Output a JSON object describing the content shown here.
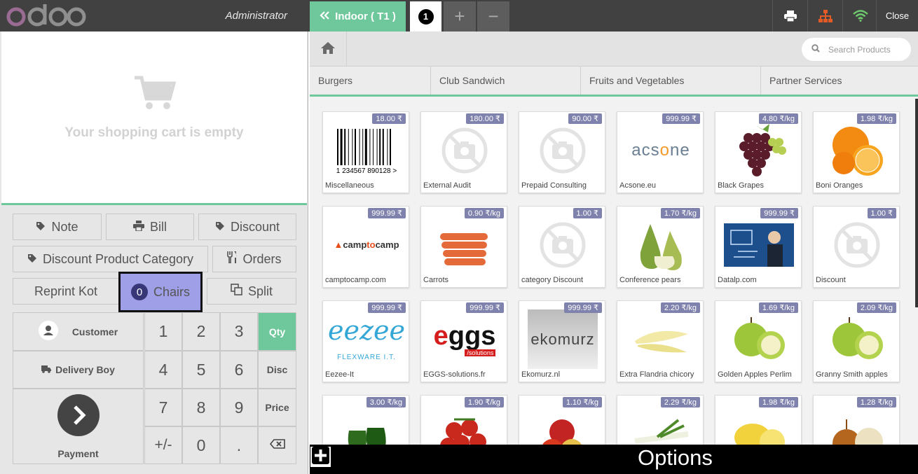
{
  "header": {
    "logo": "odoo",
    "user": "Administrator",
    "current_order": "Indoor ( T1 )",
    "order_number": "1",
    "add_label": "+",
    "delete_label": "−",
    "close_label": "Close",
    "icons": [
      "printer-icon",
      "sitemap-icon",
      "wifi-icon"
    ],
    "wifi_color": "#6ec86e",
    "sitemap_color": "#e25b26"
  },
  "cart": {
    "empty_message": "Your shopping cart is empty"
  },
  "controls": {
    "note": "Note",
    "bill": "Bill",
    "discount": "Discount",
    "discount_category": "Discount Product Category",
    "orders": "Orders",
    "reprint": "Reprint Kot",
    "chairs_count": "0",
    "chairs": "Chairs",
    "split": "Split"
  },
  "numpad": {
    "customer": "Customer",
    "delivery_boy": "Delivery Boy",
    "payment": "Payment",
    "keys": [
      "1",
      "2",
      "3",
      "4",
      "5",
      "6",
      "7",
      "8",
      "9",
      "+/-",
      "0",
      "."
    ],
    "modes": [
      "Qty",
      "Disc",
      "Price"
    ],
    "active_mode": "Qty"
  },
  "products_header": {
    "search_placeholder": "Search Products",
    "categories": [
      "Burgers",
      "Club Sandwich",
      "Fruits and Vegetables",
      "Partner Services"
    ]
  },
  "products": [
    {
      "name": "Miscellaneous",
      "price": "18.00 ₹",
      "img": "barcode",
      "barcode": "1 234567 890128 >"
    },
    {
      "name": "External Audit",
      "price": "180.00 ₹",
      "img": "no-image"
    },
    {
      "name": "Prepaid Consulting",
      "price": "90.00 ₹",
      "img": "no-image"
    },
    {
      "name": "Acsone.eu",
      "price": "999.99 ₹",
      "img": "logo",
      "logo_text": "acsone"
    },
    {
      "name": "Black Grapes",
      "price": "4.80 ₹/kg",
      "img": "grapes"
    },
    {
      "name": "Boni Oranges",
      "price": "1.98 ₹/kg",
      "img": "oranges"
    },
    {
      "name": "camptocamp.com",
      "price": "999.99 ₹",
      "img": "logo",
      "logo_text": "camptocamp"
    },
    {
      "name": "Carrots",
      "price": "0.90 ₹/kg",
      "img": "carrots"
    },
    {
      "name": "category Discount",
      "price": "1.00 ₹",
      "img": "no-image"
    },
    {
      "name": "Conference pears",
      "price": "1.70 ₹/kg",
      "img": "pears"
    },
    {
      "name": "Datalp.com",
      "price": "999.99 ₹",
      "img": "datalp"
    },
    {
      "name": "Discount",
      "price": "1.00 ₹",
      "img": "no-image"
    },
    {
      "name": "Eezee-It",
      "price": "999.99 ₹",
      "img": "eezee",
      "logo_text": "eezee",
      "sub_text": "FLEXWARE I.T."
    },
    {
      "name": "EGGS-solutions.fr",
      "price": "999.99 ₹",
      "img": "eggs",
      "logo_text": "eggs",
      "sub_text": "/solutions"
    },
    {
      "name": "Ekomurz.nl",
      "price": "999.99 ₹",
      "img": "ekomurz",
      "logo_text": "ekomurz"
    },
    {
      "name": "Extra Flandria chicory",
      "price": "2.20 ₹/kg",
      "img": "chicory"
    },
    {
      "name": "Golden Apples Perlim",
      "price": "1.69 ₹/kg",
      "img": "apple"
    },
    {
      "name": "Granny Smith apples",
      "price": "2.09 ₹/kg",
      "img": "apple"
    },
    {
      "name": "",
      "price": "3.00 ₹/kg",
      "img": "peppers"
    },
    {
      "name": "",
      "price": "1.90 ₹/kg",
      "img": "tomatoes"
    },
    {
      "name": "",
      "price": "1.10 ₹/kg",
      "img": "redapples"
    },
    {
      "name": "",
      "price": "2.29 ₹/kg",
      "img": "leeks"
    },
    {
      "name": "",
      "price": "1.98 ₹/kg",
      "img": "lemons"
    },
    {
      "name": "",
      "price": "1.28 ₹/kg",
      "img": "onions"
    }
  ],
  "footer": {
    "options_label": "Options"
  }
}
